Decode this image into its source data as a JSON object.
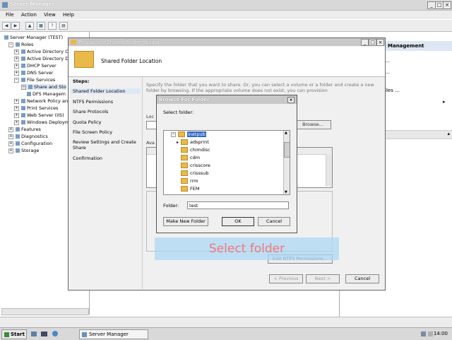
{
  "server_manager": {
    "title": "Server Manager",
    "menu": [
      "File",
      "Action",
      "View",
      "Help"
    ],
    "tree": [
      {
        "label": "Server Manager (TEST)",
        "indent": 0
      },
      {
        "label": "Roles",
        "indent": 1
      },
      {
        "label": "Active Directory C",
        "indent": 2
      },
      {
        "label": "Active Directory D",
        "indent": 2
      },
      {
        "label": "DHCP Server",
        "indent": 2
      },
      {
        "label": "DNS Server",
        "indent": 2
      },
      {
        "label": "File Services",
        "indent": 2
      },
      {
        "label": "Share and Sto",
        "indent": 3
      },
      {
        "label": "DFS Managem",
        "indent": 3
      },
      {
        "label": "Network Policy an",
        "indent": 2
      },
      {
        "label": "Print Services",
        "indent": 2
      },
      {
        "label": "Web Server (IIS)",
        "indent": 2
      },
      {
        "label": "Windows Deploym",
        "indent": 2
      },
      {
        "label": "Features",
        "indent": 1
      },
      {
        "label": "Diagnostics",
        "indent": 1
      },
      {
        "label": "Configuration",
        "indent": 1
      },
      {
        "label": "Storage",
        "indent": 1
      }
    ],
    "right_panel": {
      "header": "Management",
      "items": [
        "…",
        "…",
        "iles …"
      ]
    }
  },
  "taskbar": {
    "start_label": "Start",
    "task_label": "Server Manager",
    "clock": "14:00"
  },
  "wizard": {
    "title": "Provision a Shared Folder Wizard",
    "header": "Shared Folder Location",
    "steps_heading": "Steps:",
    "steps": [
      "Shared Folder Location",
      "NTFS Permissions",
      "Share Protocols",
      "Quota Policy",
      "File Screen Policy",
      "Review Settings and Create Share",
      "Confirmation"
    ],
    "body_text": "Specify the folder that you want to share. Or, you can select a volume or a folder and create a new folder by browsing. If the appropriate volume does not exist, you can provision",
    "location_label": "Loc",
    "browse_label": "Browse...",
    "available_label": "Ava",
    "edit_perms_label": "Edit NTFS Permissions...",
    "buttons": {
      "previous": "< Previous",
      "next": "Next >",
      "cancel": "Cancel"
    }
  },
  "browse_dialog": {
    "title": "Browse For Folder",
    "prompt": "Select folder:",
    "folders": [
      "inetpub",
      "adsprint",
      "chimdisc",
      "cdm",
      "crisscore",
      "crisssub",
      "rrm",
      "FEM"
    ],
    "selected": "inetpub",
    "folder_label": "Folder:",
    "folder_value": "test",
    "make_new_label": "Make New Folder",
    "ok_label": "OK",
    "cancel_label": "Cancel"
  },
  "overlay": {
    "text": "Select folder"
  }
}
